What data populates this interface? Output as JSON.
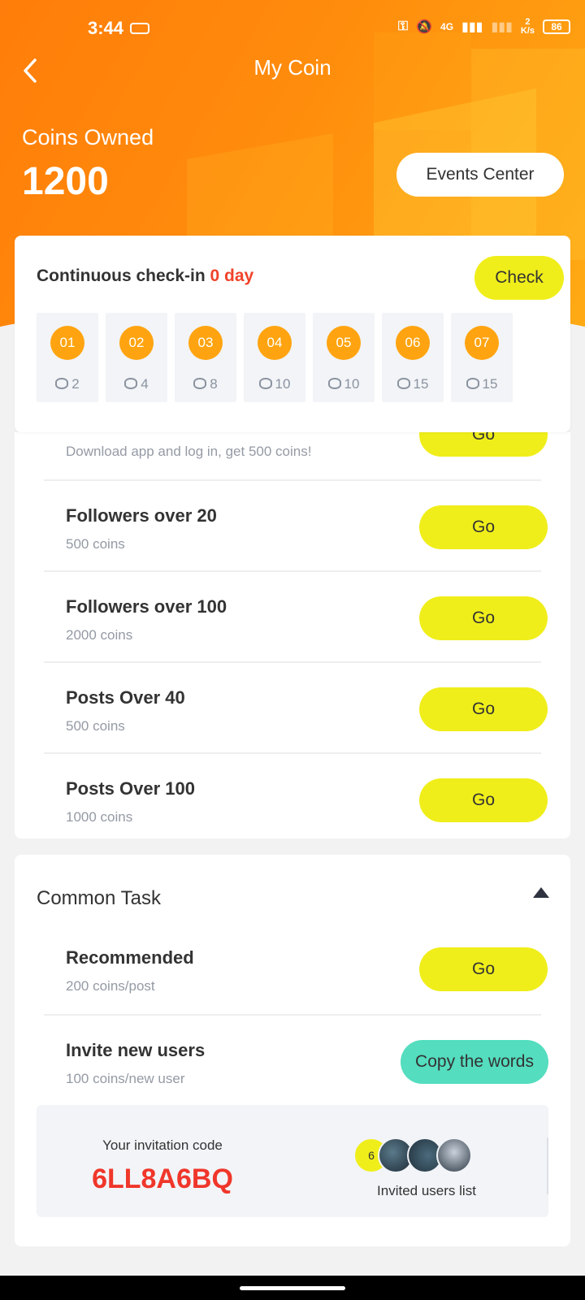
{
  "status_bar": {
    "time": "3:44",
    "network": "4G",
    "speed_value": "2",
    "speed_unit": "K/s",
    "battery": "86"
  },
  "header": {
    "title": "My Coin",
    "coins_label": "Coins Owned",
    "coins_value": "1200",
    "events_button": "Events Center"
  },
  "checkin": {
    "title": "Continuous check-in",
    "days_value": "0 day",
    "check_button": "Check",
    "days": [
      {
        "day": "01",
        "coins": "2"
      },
      {
        "day": "02",
        "coins": "4"
      },
      {
        "day": "03",
        "coins": "8"
      },
      {
        "day": "04",
        "coins": "10"
      },
      {
        "day": "05",
        "coins": "10"
      },
      {
        "day": "06",
        "coins": "15"
      },
      {
        "day": "07",
        "coins": "15"
      }
    ]
  },
  "tasks": [
    {
      "title": "",
      "subtitle": "Download app and log in, get 500 coins!",
      "button": "Go"
    },
    {
      "title": "Followers over 20",
      "subtitle": "500 coins",
      "button": "Go"
    },
    {
      "title": "Followers over 100",
      "subtitle": "2000 coins",
      "button": "Go"
    },
    {
      "title": "Posts Over 40",
      "subtitle": "500 coins",
      "button": "Go"
    },
    {
      "title": "Posts Over 100",
      "subtitle": "1000 coins",
      "button": "Go"
    }
  ],
  "common_task": {
    "title": "Common Task",
    "items": [
      {
        "title": "Recommended",
        "subtitle": "200 coins/post",
        "button": "Go"
      },
      {
        "title": "Invite new users",
        "subtitle": "100 coins/new user",
        "button": "Copy the words"
      }
    ],
    "invite": {
      "code_label": "Your invitation code",
      "code": "6LL8A6BQ",
      "invited_count": "6",
      "invited_label": "Invited users list"
    }
  },
  "colors": {
    "header_gradient_start": "#ff7d0a",
    "header_gradient_end": "#ffab14",
    "accent_yellow": "#f0ee1a",
    "accent_teal": "#54ddbf",
    "day_circle": "#ffa410",
    "highlight_red": "#f0432a"
  },
  "icons": [
    "back-arrow-icon",
    "collapse-up-icon",
    "coin-icon"
  ]
}
